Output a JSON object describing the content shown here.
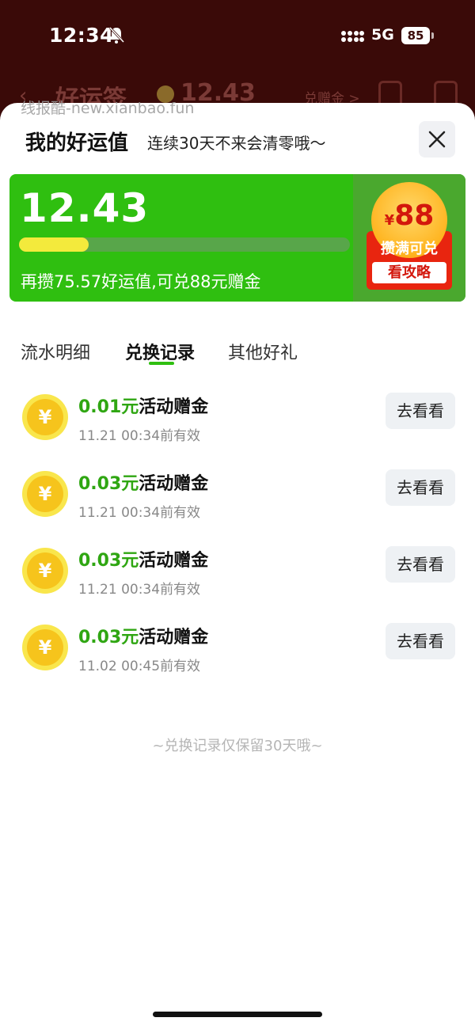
{
  "status_bar": {
    "time": "12:34",
    "network": "5G",
    "battery": "85"
  },
  "background_header": {
    "back_glyph": "‹",
    "title": "好运签",
    "value": "12.43",
    "link": "兑赠金 >"
  },
  "watermark": "线报酷-new.xianbao.fun",
  "sheet": {
    "title": "我的好运值",
    "subtitle": "连续30天不来会清零哦～"
  },
  "card": {
    "value": "12.43",
    "progress_fraction": 0.1411,
    "description": "再攒75.57好运值,可兑88元赠金",
    "badge": {
      "currency": "¥",
      "amount": "88",
      "label": "攒满可兑",
      "button": "看攻略"
    },
    "colors": {
      "card_bg": "#2fbf10",
      "progress_fill": "#f3ea3c",
      "badge_red": "#e8250f"
    }
  },
  "tabs": [
    {
      "label": "流水明细",
      "active": false
    },
    {
      "label": "兑换记录",
      "active": true
    },
    {
      "label": "其他好礼",
      "active": false
    }
  ],
  "records": [
    {
      "amount": "0.01元",
      "title": "活动赠金",
      "expiry": "11.21 00:34前有效",
      "button": "去看看",
      "coin": "¥"
    },
    {
      "amount": "0.03元",
      "title": "活动赠金",
      "expiry": "11.21 00:34前有效",
      "button": "去看看",
      "coin": "¥"
    },
    {
      "amount": "0.03元",
      "title": "活动赠金",
      "expiry": "11.21 00:34前有效",
      "button": "去看看",
      "coin": "¥"
    },
    {
      "amount": "0.03元",
      "title": "活动赠金",
      "expiry": "11.02 00:45前有效",
      "button": "去看看",
      "coin": "¥"
    }
  ],
  "footer_note": "~兑换记录仅保留30天哦~"
}
